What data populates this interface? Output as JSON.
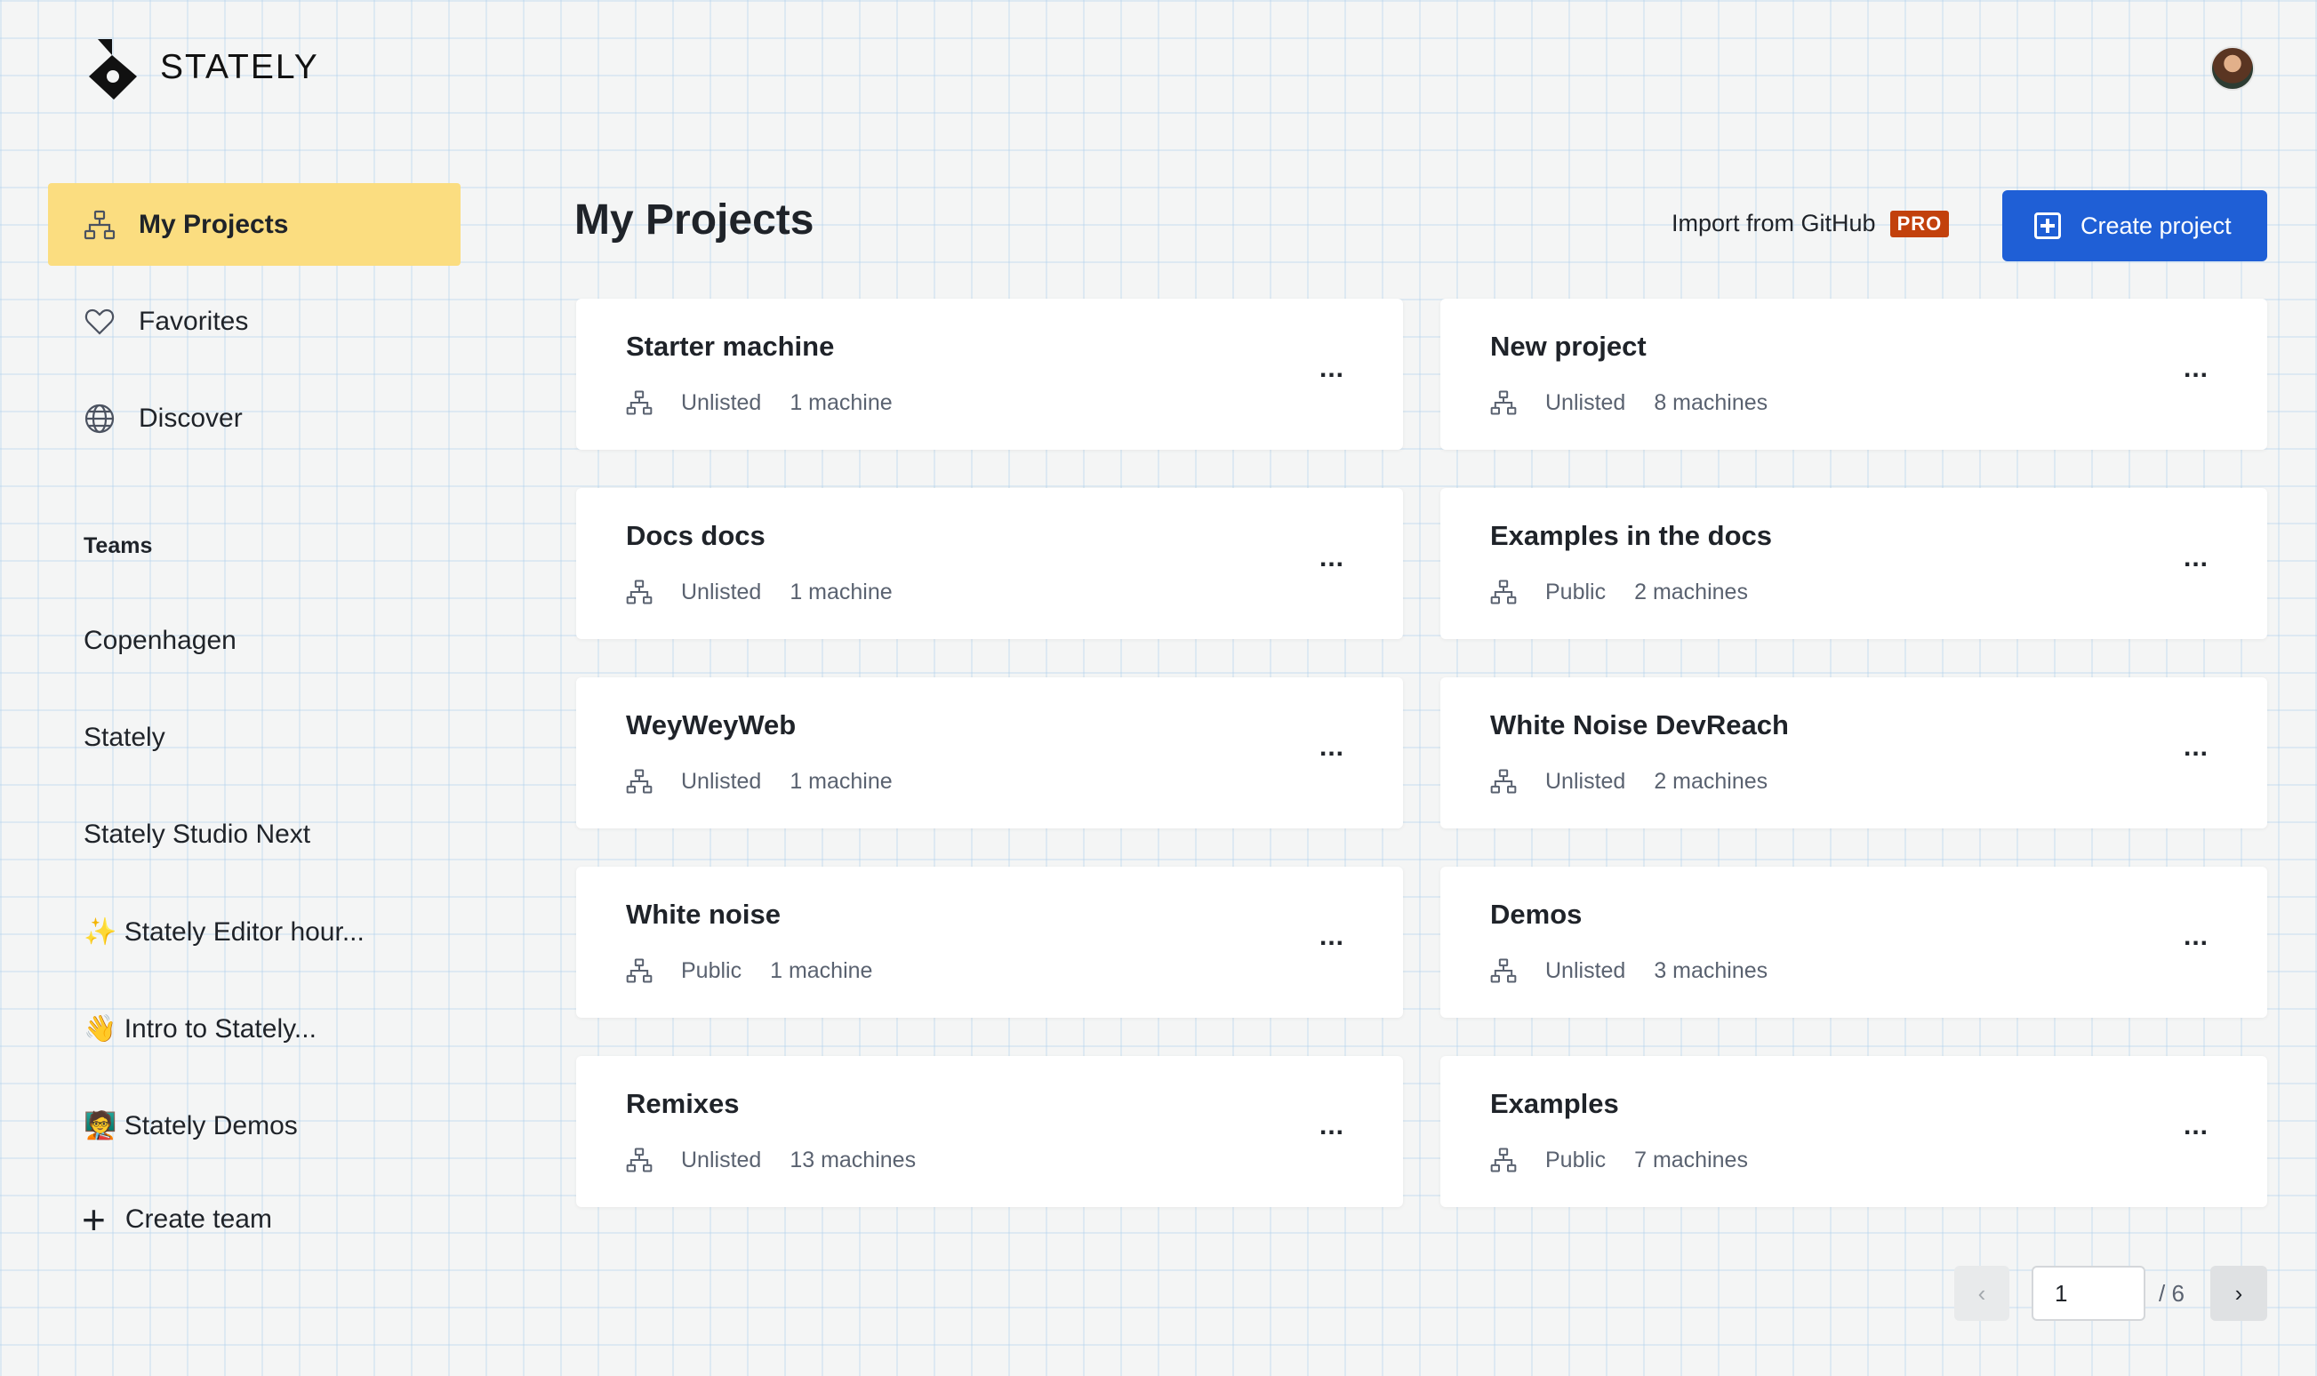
{
  "brand": {
    "name": "STATELY"
  },
  "sidebar": {
    "nav": [
      {
        "label": "My Projects",
        "icon": "hierarchy-icon",
        "active": true
      },
      {
        "label": "Favorites",
        "icon": "heart-icon",
        "active": false
      },
      {
        "label": "Discover",
        "icon": "globe-icon",
        "active": false
      }
    ],
    "teams_title": "Teams",
    "teams": [
      "Copenhagen",
      "Stately",
      "Stately Studio Next",
      "✨ Stately Editor hour...",
      "👋 Intro to Stately...",
      "🧑‍🏫 Stately Demos"
    ],
    "create_team": "Create team"
  },
  "main": {
    "title": "My Projects",
    "import_label": "Import from GitHub",
    "pro_badge": "PRO",
    "create_label": "Create project"
  },
  "projects": [
    {
      "title": "Starter machine",
      "visibility": "Unlisted",
      "count": "1 machine"
    },
    {
      "title": "New project",
      "visibility": "Unlisted",
      "count": "8 machines"
    },
    {
      "title": "Docs docs",
      "visibility": "Unlisted",
      "count": "1 machine"
    },
    {
      "title": "Examples in the docs",
      "visibility": "Public",
      "count": "2 machines"
    },
    {
      "title": "WeyWeyWeb",
      "visibility": "Unlisted",
      "count": "1 machine"
    },
    {
      "title": "White Noise DevReach",
      "visibility": "Unlisted",
      "count": "2 machines"
    },
    {
      "title": "White noise",
      "visibility": "Public",
      "count": "1 machine"
    },
    {
      "title": "Demos",
      "visibility": "Unlisted",
      "count": "3 machines"
    },
    {
      "title": "Remixes",
      "visibility": "Unlisted",
      "count": "13 machines"
    },
    {
      "title": "Examples",
      "visibility": "Public",
      "count": "7 machines"
    }
  ],
  "card_menu": "...",
  "pagination": {
    "prev": "‹",
    "current": "1",
    "total": "/ 6",
    "next": "›"
  },
  "colors": {
    "accent": "#1f5fd6",
    "active_nav": "#fbdd80",
    "pro": "#c2410c"
  }
}
